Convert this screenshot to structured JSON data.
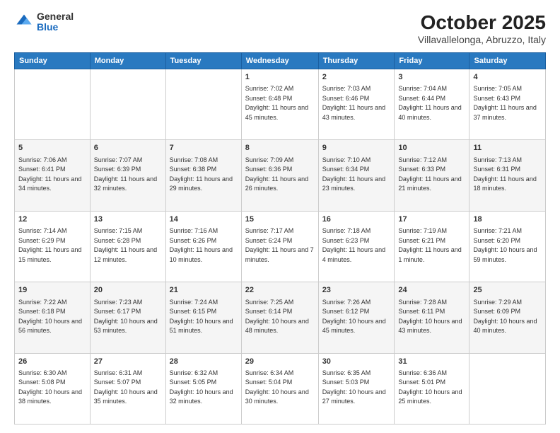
{
  "logo": {
    "general": "General",
    "blue": "Blue"
  },
  "title": "October 2025",
  "location": "Villavallelonga, Abruzzo, Italy",
  "days_of_week": [
    "Sunday",
    "Monday",
    "Tuesday",
    "Wednesday",
    "Thursday",
    "Friday",
    "Saturday"
  ],
  "weeks": [
    [
      {
        "day": "",
        "info": ""
      },
      {
        "day": "",
        "info": ""
      },
      {
        "day": "",
        "info": ""
      },
      {
        "day": "1",
        "info": "Sunrise: 7:02 AM\nSunset: 6:48 PM\nDaylight: 11 hours and 45 minutes."
      },
      {
        "day": "2",
        "info": "Sunrise: 7:03 AM\nSunset: 6:46 PM\nDaylight: 11 hours and 43 minutes."
      },
      {
        "day": "3",
        "info": "Sunrise: 7:04 AM\nSunset: 6:44 PM\nDaylight: 11 hours and 40 minutes."
      },
      {
        "day": "4",
        "info": "Sunrise: 7:05 AM\nSunset: 6:43 PM\nDaylight: 11 hours and 37 minutes."
      }
    ],
    [
      {
        "day": "5",
        "info": "Sunrise: 7:06 AM\nSunset: 6:41 PM\nDaylight: 11 hours and 34 minutes."
      },
      {
        "day": "6",
        "info": "Sunrise: 7:07 AM\nSunset: 6:39 PM\nDaylight: 11 hours and 32 minutes."
      },
      {
        "day": "7",
        "info": "Sunrise: 7:08 AM\nSunset: 6:38 PM\nDaylight: 11 hours and 29 minutes."
      },
      {
        "day": "8",
        "info": "Sunrise: 7:09 AM\nSunset: 6:36 PM\nDaylight: 11 hours and 26 minutes."
      },
      {
        "day": "9",
        "info": "Sunrise: 7:10 AM\nSunset: 6:34 PM\nDaylight: 11 hours and 23 minutes."
      },
      {
        "day": "10",
        "info": "Sunrise: 7:12 AM\nSunset: 6:33 PM\nDaylight: 11 hours and 21 minutes."
      },
      {
        "day": "11",
        "info": "Sunrise: 7:13 AM\nSunset: 6:31 PM\nDaylight: 11 hours and 18 minutes."
      }
    ],
    [
      {
        "day": "12",
        "info": "Sunrise: 7:14 AM\nSunset: 6:29 PM\nDaylight: 11 hours and 15 minutes."
      },
      {
        "day": "13",
        "info": "Sunrise: 7:15 AM\nSunset: 6:28 PM\nDaylight: 11 hours and 12 minutes."
      },
      {
        "day": "14",
        "info": "Sunrise: 7:16 AM\nSunset: 6:26 PM\nDaylight: 11 hours and 10 minutes."
      },
      {
        "day": "15",
        "info": "Sunrise: 7:17 AM\nSunset: 6:24 PM\nDaylight: 11 hours and 7 minutes."
      },
      {
        "day": "16",
        "info": "Sunrise: 7:18 AM\nSunset: 6:23 PM\nDaylight: 11 hours and 4 minutes."
      },
      {
        "day": "17",
        "info": "Sunrise: 7:19 AM\nSunset: 6:21 PM\nDaylight: 11 hours and 1 minute."
      },
      {
        "day": "18",
        "info": "Sunrise: 7:21 AM\nSunset: 6:20 PM\nDaylight: 10 hours and 59 minutes."
      }
    ],
    [
      {
        "day": "19",
        "info": "Sunrise: 7:22 AM\nSunset: 6:18 PM\nDaylight: 10 hours and 56 minutes."
      },
      {
        "day": "20",
        "info": "Sunrise: 7:23 AM\nSunset: 6:17 PM\nDaylight: 10 hours and 53 minutes."
      },
      {
        "day": "21",
        "info": "Sunrise: 7:24 AM\nSunset: 6:15 PM\nDaylight: 10 hours and 51 minutes."
      },
      {
        "day": "22",
        "info": "Sunrise: 7:25 AM\nSunset: 6:14 PM\nDaylight: 10 hours and 48 minutes."
      },
      {
        "day": "23",
        "info": "Sunrise: 7:26 AM\nSunset: 6:12 PM\nDaylight: 10 hours and 45 minutes."
      },
      {
        "day": "24",
        "info": "Sunrise: 7:28 AM\nSunset: 6:11 PM\nDaylight: 10 hours and 43 minutes."
      },
      {
        "day": "25",
        "info": "Sunrise: 7:29 AM\nSunset: 6:09 PM\nDaylight: 10 hours and 40 minutes."
      }
    ],
    [
      {
        "day": "26",
        "info": "Sunrise: 6:30 AM\nSunset: 5:08 PM\nDaylight: 10 hours and 38 minutes."
      },
      {
        "day": "27",
        "info": "Sunrise: 6:31 AM\nSunset: 5:07 PM\nDaylight: 10 hours and 35 minutes."
      },
      {
        "day": "28",
        "info": "Sunrise: 6:32 AM\nSunset: 5:05 PM\nDaylight: 10 hours and 32 minutes."
      },
      {
        "day": "29",
        "info": "Sunrise: 6:34 AM\nSunset: 5:04 PM\nDaylight: 10 hours and 30 minutes."
      },
      {
        "day": "30",
        "info": "Sunrise: 6:35 AM\nSunset: 5:03 PM\nDaylight: 10 hours and 27 minutes."
      },
      {
        "day": "31",
        "info": "Sunrise: 6:36 AM\nSunset: 5:01 PM\nDaylight: 10 hours and 25 minutes."
      },
      {
        "day": "",
        "info": ""
      }
    ]
  ]
}
